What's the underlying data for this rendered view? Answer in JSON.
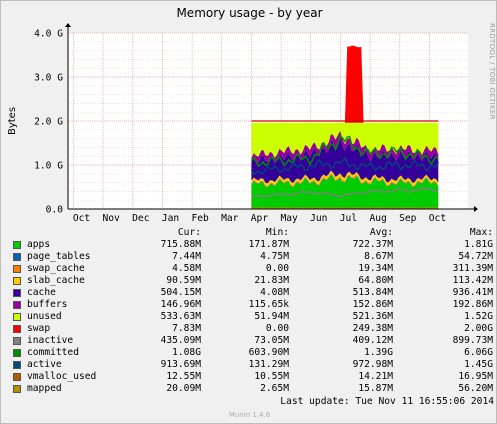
{
  "chart_data": {
    "type": "area",
    "title": "Memory usage - by year",
    "ylabel": "Bytes",
    "ylim": [
      0,
      4.0
    ],
    "y_unit": "G",
    "y_ticks": [
      "0.0",
      "1.0 G",
      "2.0 G",
      "3.0 G",
      "4.0 G"
    ],
    "x_ticks": [
      "Oct",
      "Nov",
      "Dec",
      "Jan",
      "Feb",
      "Mar",
      "Apr",
      "May",
      "Jun",
      "Jul",
      "Aug",
      "Sep",
      "Oct"
    ],
    "grid": true,
    "x_range": [
      "Sep 2013",
      "Nov 2014"
    ],
    "data_start_month_index": 6,
    "series": [
      {
        "name": "apps",
        "color": "#00cc00",
        "stack": true,
        "months": [
          6,
          7,
          8,
          9,
          10,
          11,
          12
        ],
        "values": [
          0.55,
          0.58,
          0.6,
          0.7,
          0.62,
          0.58,
          0.6
        ]
      },
      {
        "name": "page_tables",
        "color": "#0066b3",
        "stack": true,
        "months": [
          6,
          7,
          8,
          9,
          10,
          11,
          12
        ],
        "values": [
          0.01,
          0.01,
          0.01,
          0.01,
          0.01,
          0.01,
          0.01
        ]
      },
      {
        "name": "swap_cache",
        "color": "#ff8000",
        "stack": true,
        "months": [
          6,
          7,
          8,
          9,
          10,
          11,
          12
        ],
        "values": [
          0.02,
          0.02,
          0.02,
          0.03,
          0.02,
          0.02,
          0.02
        ]
      },
      {
        "name": "slab_cache",
        "color": "#ffcc00",
        "stack": true,
        "months": [
          6,
          7,
          8,
          9,
          10,
          11,
          12
        ],
        "values": [
          0.06,
          0.06,
          0.06,
          0.07,
          0.06,
          0.06,
          0.06
        ]
      },
      {
        "name": "cache",
        "color": "#330099",
        "stack": true,
        "months": [
          6,
          7,
          8,
          9,
          10,
          11,
          12
        ],
        "values": [
          0.45,
          0.5,
          0.55,
          0.7,
          0.5,
          0.55,
          0.5
        ]
      },
      {
        "name": "buffers",
        "color": "#990099",
        "stack": true,
        "months": [
          6,
          7,
          8,
          9,
          10,
          11,
          12
        ],
        "values": [
          0.12,
          0.13,
          0.14,
          0.16,
          0.14,
          0.15,
          0.14
        ]
      },
      {
        "name": "unused",
        "color": "#ccff00",
        "stack": true,
        "months": [
          6,
          7,
          8,
          9,
          10,
          11,
          12
        ],
        "values": [
          0.79,
          0.7,
          0.62,
          0.33,
          0.65,
          0.63,
          0.67
        ]
      },
      {
        "name": "swap",
        "color": "#ff0000",
        "stack": true,
        "months": [
          6,
          7,
          8,
          9,
          10,
          11,
          12
        ],
        "values": [
          0.0,
          0.0,
          0.0,
          1.73,
          0.0,
          0.0,
          0.0
        ]
      },
      {
        "name": "inactive",
        "color": "#808080",
        "stack": false,
        "months": [
          6,
          7,
          8,
          9,
          10,
          11,
          12
        ],
        "values": [
          0.28,
          0.33,
          0.38,
          0.3,
          0.4,
          0.42,
          0.45
        ]
      },
      {
        "name": "committed",
        "color": "#008f00",
        "stack": false,
        "months": [
          6,
          7,
          8,
          9,
          10,
          11,
          12
        ],
        "values": [
          1.05,
          1.1,
          1.15,
          1.6,
          1.25,
          1.3,
          1.15
        ]
      },
      {
        "name": "active",
        "color": "#00487d",
        "stack": false,
        "months": [
          6,
          7,
          8,
          9,
          10,
          11,
          12
        ],
        "values": [
          0.85,
          0.92,
          0.98,
          1.05,
          0.95,
          1.0,
          0.98
        ]
      },
      {
        "name": "vmalloc_used",
        "color": "#b35a00",
        "stack": false,
        "months": [
          6,
          7,
          8,
          9,
          10,
          11,
          12
        ],
        "values": [
          0.01,
          0.01,
          0.01,
          0.01,
          0.01,
          0.01,
          0.01
        ]
      },
      {
        "name": "mapped",
        "color": "#b38f00",
        "stack": false,
        "months": [
          6,
          7,
          8,
          9,
          10,
          11,
          12
        ],
        "values": [
          0.02,
          0.02,
          0.02,
          0.02,
          0.02,
          0.02,
          0.02
        ]
      }
    ],
    "max_line": {
      "name": "total",
      "color": "#cc0000",
      "value": 2.0
    }
  },
  "legend": {
    "headers": {
      "cur": "Cur:",
      "min": "Min:",
      "avg": "Avg:",
      "max": "Max:"
    },
    "rows": [
      {
        "name": "apps",
        "color": "#00cc00",
        "cur": "715.88M",
        "min": "171.87M",
        "avg": "722.37M",
        "max": "1.81G"
      },
      {
        "name": "page_tables",
        "color": "#0066b3",
        "cur": "7.44M",
        "min": "4.75M",
        "avg": "8.67M",
        "max": "54.72M"
      },
      {
        "name": "swap_cache",
        "color": "#ff8000",
        "cur": "4.58M",
        "min": "0.00",
        "avg": "19.34M",
        "max": "311.39M"
      },
      {
        "name": "slab_cache",
        "color": "#ffcc00",
        "cur": "90.59M",
        "min": "21.83M",
        "avg": "64.80M",
        "max": "113.42M"
      },
      {
        "name": "cache",
        "color": "#330099",
        "cur": "504.15M",
        "min": "4.08M",
        "avg": "513.84M",
        "max": "936.41M"
      },
      {
        "name": "buffers",
        "color": "#990099",
        "cur": "146.96M",
        "min": "115.65k",
        "avg": "152.86M",
        "max": "192.86M"
      },
      {
        "name": "unused",
        "color": "#ccff00",
        "cur": "533.63M",
        "min": "51.94M",
        "avg": "521.36M",
        "max": "1.52G"
      },
      {
        "name": "swap",
        "color": "#ff0000",
        "cur": "7.83M",
        "min": "0.00",
        "avg": "249.38M",
        "max": "2.00G"
      },
      {
        "name": "inactive",
        "color": "#808080",
        "cur": "435.09M",
        "min": "73.05M",
        "avg": "409.12M",
        "max": "899.73M"
      },
      {
        "name": "committed",
        "color": "#008f00",
        "cur": "1.08G",
        "min": "603.90M",
        "avg": "1.39G",
        "max": "6.06G"
      },
      {
        "name": "active",
        "color": "#00487d",
        "cur": "913.69M",
        "min": "131.29M",
        "avg": "972.98M",
        "max": "1.45G"
      },
      {
        "name": "vmalloc_used",
        "color": "#b35a00",
        "cur": "12.55M",
        "min": "10.55M",
        "avg": "14.21M",
        "max": "16.95M"
      },
      {
        "name": "mapped",
        "color": "#b38f00",
        "cur": "20.09M",
        "min": "2.65M",
        "avg": "15.87M",
        "max": "56.20M"
      }
    ]
  },
  "last_update": "Last update:  Tue Nov 11 16:55:06 2014",
  "watermark": "RRDTOOL / TOBI OETIKER",
  "footer": "Munin 1.4.6"
}
